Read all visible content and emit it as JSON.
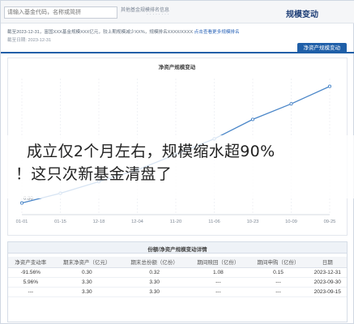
{
  "search": {
    "placeholder": "请输入基金代码，名称或简拼",
    "hint": "其他基金规模排名信息",
    "sub": "· · · · · · · ·"
  },
  "header": {
    "title": "规模变动"
  },
  "info": {
    "text": "截至2023-12-31，富国XXX基金规模XXX亿元，较上期规模减少XX%，规模排名XXXX/XXXX",
    "link": "点击查看更多规模排名",
    "date": "截至日期: 2023-12-31"
  },
  "tab": {
    "label": "净资产规模变动"
  },
  "chart": {
    "title": "净资产规模变动"
  },
  "chart_data": {
    "type": "line",
    "title": "净资产规模变动",
    "x": [
      "01-01",
      "01-15",
      "12-18",
      "12-04",
      "11-20",
      "11-06",
      "10-23",
      "10-09",
      "09-25"
    ],
    "values": [
      0.3,
      0.55,
      0.85,
      1.15,
      1.55,
      1.95,
      2.45,
      2.85,
      3.3
    ],
    "start_label": "0.30",
    "ylim": [
      0,
      3.5
    ],
    "grid": true,
    "line_color": "#4a86c8"
  },
  "overlay": {
    "line1": "成立仅2个月左右，规模缩水超90%",
    "line2": "！这只次新基金清盘了"
  },
  "table": {
    "title": "份额/净资产规模变动详情",
    "headers": [
      "日期",
      "期间申购（亿份）",
      "期间赎回（亿份）",
      "期末总份额（亿份）",
      "期末净资产（亿元）",
      "净资产变动率"
    ],
    "rows": [
      [
        "2023-12-31",
        "0.15",
        "1.08",
        "0.32",
        "0.30",
        "-91.56%"
      ],
      [
        "2023-09-30",
        "---",
        "---",
        "3.30",
        "3.30",
        "5.96%"
      ],
      [
        "2023-09-15",
        "---",
        "---",
        "3.30",
        "3.30",
        "---"
      ]
    ]
  }
}
